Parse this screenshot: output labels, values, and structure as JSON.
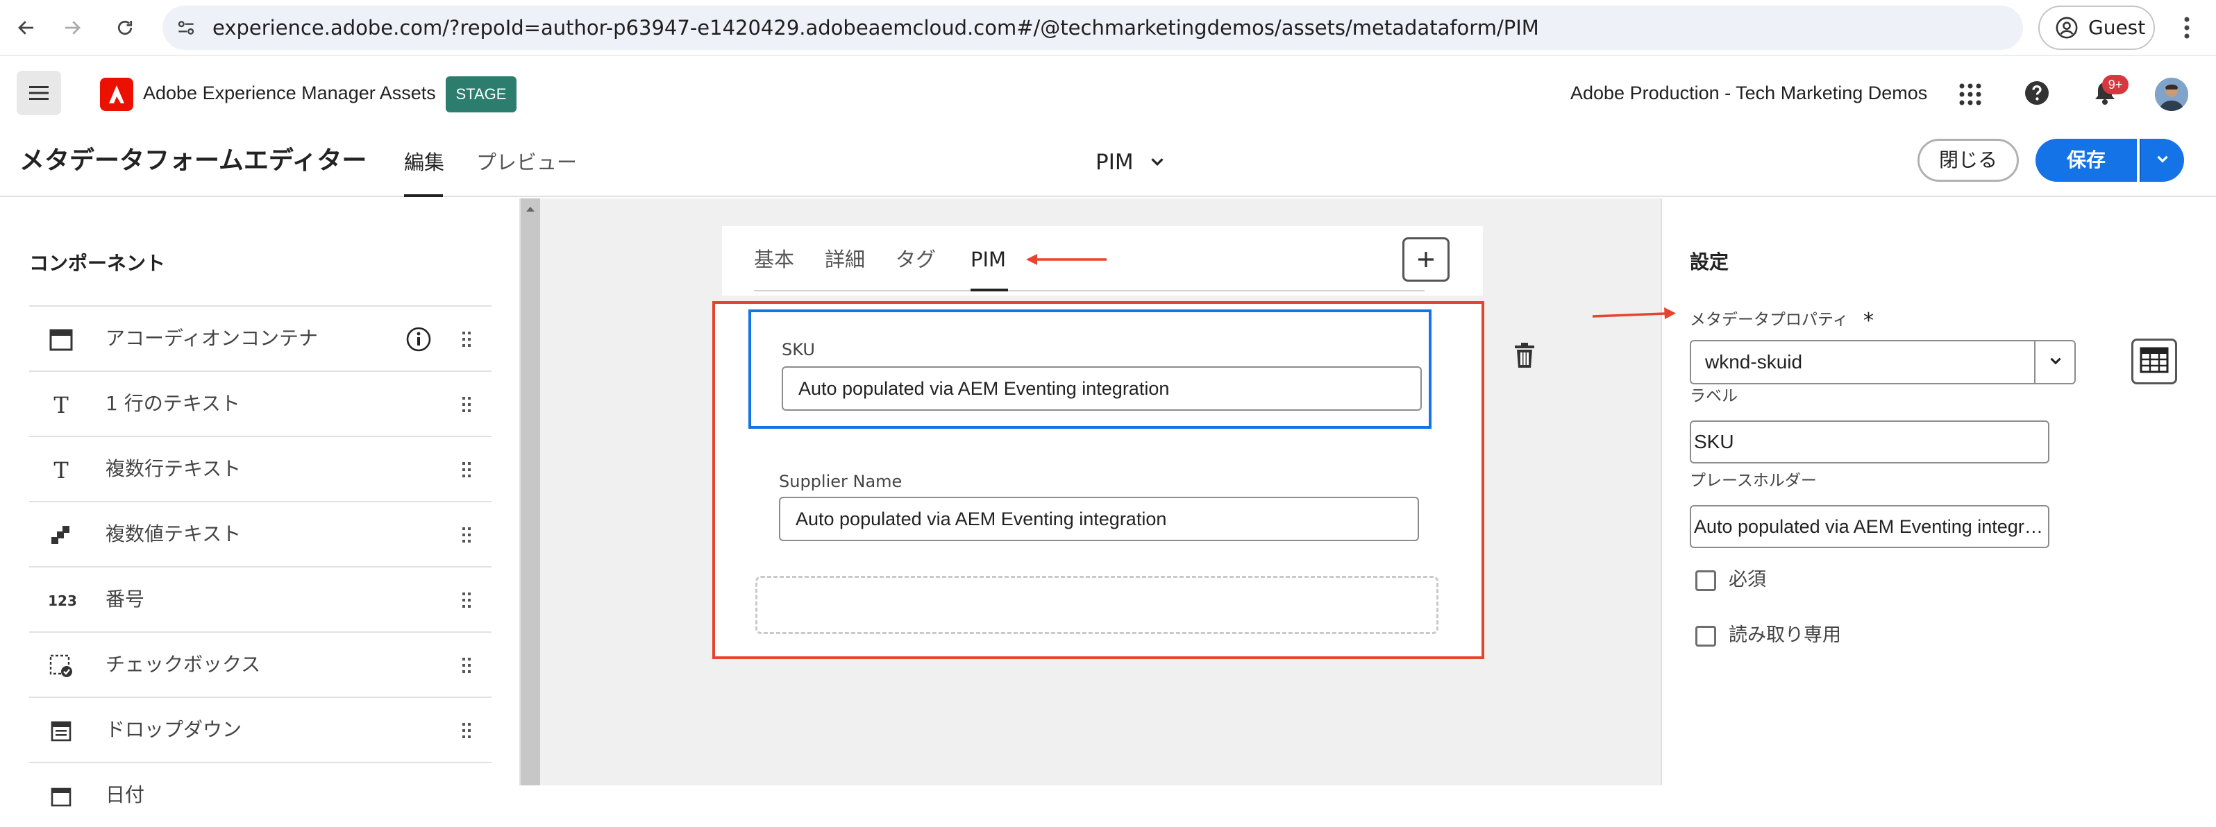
{
  "browser": {
    "url": "experience.adobe.com/?repoId=author-p63947-e1420429.adobeaemcloud.com#/@techmarketingdemos/assets/metadataform/PIM",
    "profile_label": "Guest"
  },
  "app_header": {
    "app_name": "Adobe Experience Manager Assets",
    "environment_badge": "STAGE",
    "org_name": "Adobe Production - Tech Marketing Demos",
    "notification_count": "9+"
  },
  "editor": {
    "title": "メタデータフォームエディター",
    "tabs": [
      {
        "label": "編集",
        "active": true
      },
      {
        "label": "プレビュー",
        "active": false
      }
    ],
    "form_name": "PIM",
    "close_label": "閉じる",
    "save_label": "保存"
  },
  "components_panel": {
    "title": "コンポーネント",
    "items": [
      {
        "label": "アコーディオンコンテナ",
        "icon": "accordion-icon",
        "has_info": true
      },
      {
        "label": "1 行のテキスト",
        "icon": "text-icon"
      },
      {
        "label": "複数行テキスト",
        "icon": "text-icon"
      },
      {
        "label": "複数値テキスト",
        "icon": "multi-value-icon"
      },
      {
        "label": "番号",
        "icon": "number-icon",
        "icon_text": "123"
      },
      {
        "label": "チェックボックス",
        "icon": "checkbox-icon"
      },
      {
        "label": "ドロップダウン",
        "icon": "dropdown-icon"
      },
      {
        "label": "日付",
        "icon": "date-icon"
      }
    ]
  },
  "form_canvas": {
    "tabs": [
      {
        "label": "基本",
        "active": false
      },
      {
        "label": "詳細",
        "active": false
      },
      {
        "label": "タグ",
        "active": false
      },
      {
        "label": "PIM",
        "active": true
      }
    ],
    "fields": [
      {
        "label": "SKU",
        "value": "Auto populated via AEM Eventing integration",
        "selected": true
      },
      {
        "label": "Supplier Name",
        "value": "Auto populated via AEM Eventing integration",
        "selected": false
      }
    ]
  },
  "settings_panel": {
    "title": "設定",
    "metadata_property_label": "メタデータプロパティ",
    "required_marker": "*",
    "metadata_property_value": "wknd-skuid",
    "label_label": "ラベル",
    "label_value": "SKU",
    "placeholder_label": "プレースホルダー",
    "placeholder_value": "Auto populated via AEM Eventing integration",
    "required_checkbox_label": "必須",
    "readonly_checkbox_label": "読み取り専用",
    "required_checked": false,
    "readonly_checked": false
  },
  "colors": {
    "accent_blue": "#1473e6",
    "annotation_red": "#e8432c",
    "stage_green": "#2d7d6f",
    "adobe_red": "#eb1000"
  }
}
